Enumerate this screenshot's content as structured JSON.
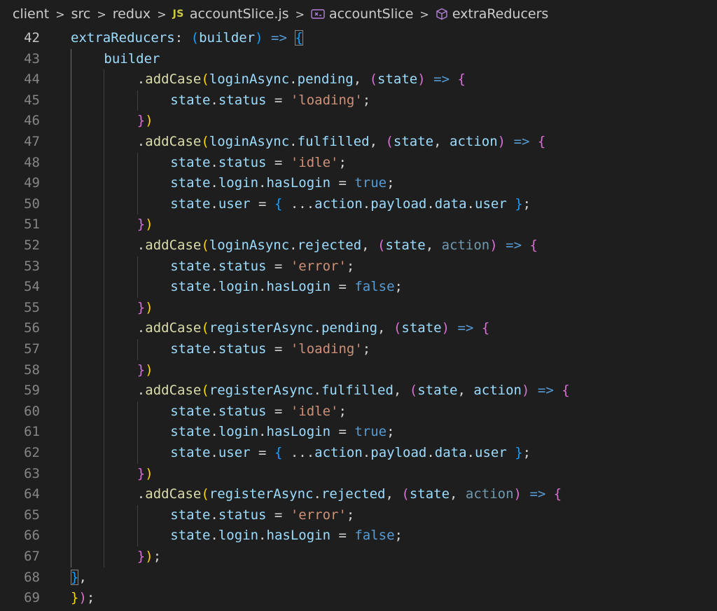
{
  "breadcrumb": {
    "items": [
      "client",
      "src",
      "redux"
    ],
    "file_badge": "JS",
    "file_name": "accountSlice.js",
    "symbol": "accountSlice",
    "member": "extraReducers",
    "separator": ">"
  },
  "editor": {
    "active_line": 42,
    "lines": [
      {
        "n": 42,
        "indent": 1,
        "tokens": [
          [
            "prop",
            "extraReducers"
          ],
          [
            "p",
            ": "
          ],
          [
            "b3",
            "("
          ],
          [
            "prop",
            "builder"
          ],
          [
            "b3",
            ")"
          ],
          [
            "p",
            " "
          ],
          [
            "kw",
            "=>"
          ],
          [
            "p",
            " "
          ],
          [
            "b3",
            "{"
          ]
        ]
      },
      {
        "n": 43,
        "indent": 2,
        "tokens": [
          [
            "prop",
            "builder"
          ]
        ]
      },
      {
        "n": 44,
        "indent": 3,
        "tokens": [
          [
            "p",
            "."
          ],
          [
            "fn",
            "addCase"
          ],
          [
            "b1",
            "("
          ],
          [
            "prop",
            "loginAsync"
          ],
          [
            "p",
            "."
          ],
          [
            "prop",
            "pending"
          ],
          [
            "p",
            ", "
          ],
          [
            "b2",
            "("
          ],
          [
            "prop",
            "state"
          ],
          [
            "b2",
            ")"
          ],
          [
            "p",
            " "
          ],
          [
            "kw",
            "=>"
          ],
          [
            "p",
            " "
          ],
          [
            "b2",
            "{"
          ]
        ]
      },
      {
        "n": 45,
        "indent": 4,
        "tokens": [
          [
            "prop",
            "state"
          ],
          [
            "p",
            "."
          ],
          [
            "prop",
            "status"
          ],
          [
            "p",
            " = "
          ],
          [
            "str",
            "'loading'"
          ],
          [
            "p",
            ";"
          ]
        ]
      },
      {
        "n": 46,
        "indent": 3,
        "tokens": [
          [
            "b2",
            "}"
          ],
          [
            "b1",
            ")"
          ]
        ]
      },
      {
        "n": 47,
        "indent": 3,
        "tokens": [
          [
            "p",
            "."
          ],
          [
            "fn",
            "addCase"
          ],
          [
            "b1",
            "("
          ],
          [
            "prop",
            "loginAsync"
          ],
          [
            "p",
            "."
          ],
          [
            "prop",
            "fulfilled"
          ],
          [
            "p",
            ", "
          ],
          [
            "b2",
            "("
          ],
          [
            "prop",
            "state"
          ],
          [
            "p",
            ", "
          ],
          [
            "prop",
            "action"
          ],
          [
            "b2",
            ")"
          ],
          [
            "p",
            " "
          ],
          [
            "kw",
            "=>"
          ],
          [
            "p",
            " "
          ],
          [
            "b2",
            "{"
          ]
        ]
      },
      {
        "n": 48,
        "indent": 4,
        "tokens": [
          [
            "prop",
            "state"
          ],
          [
            "p",
            "."
          ],
          [
            "prop",
            "status"
          ],
          [
            "p",
            " = "
          ],
          [
            "str",
            "'idle'"
          ],
          [
            "p",
            ";"
          ]
        ]
      },
      {
        "n": 49,
        "indent": 4,
        "tokens": [
          [
            "prop",
            "state"
          ],
          [
            "p",
            "."
          ],
          [
            "prop",
            "login"
          ],
          [
            "p",
            "."
          ],
          [
            "prop",
            "hasLogin"
          ],
          [
            "p",
            " = "
          ],
          [
            "kw",
            "true"
          ],
          [
            "p",
            ";"
          ]
        ]
      },
      {
        "n": 50,
        "indent": 4,
        "tokens": [
          [
            "prop",
            "state"
          ],
          [
            "p",
            "."
          ],
          [
            "prop",
            "user"
          ],
          [
            "p",
            " = "
          ],
          [
            "b3",
            "{"
          ],
          [
            "p",
            " ..."
          ],
          [
            "prop",
            "action"
          ],
          [
            "p",
            "."
          ],
          [
            "prop",
            "payload"
          ],
          [
            "p",
            "."
          ],
          [
            "prop",
            "data"
          ],
          [
            "p",
            "."
          ],
          [
            "prop",
            "user"
          ],
          [
            "p",
            " "
          ],
          [
            "b3",
            "}"
          ],
          [
            "p",
            ";"
          ]
        ]
      },
      {
        "n": 51,
        "indent": 3,
        "tokens": [
          [
            "b2",
            "}"
          ],
          [
            "b1",
            ")"
          ]
        ]
      },
      {
        "n": 52,
        "indent": 3,
        "tokens": [
          [
            "p",
            "."
          ],
          [
            "fn",
            "addCase"
          ],
          [
            "b1",
            "("
          ],
          [
            "prop",
            "loginAsync"
          ],
          [
            "p",
            "."
          ],
          [
            "prop",
            "rejected"
          ],
          [
            "p",
            ", "
          ],
          [
            "b2",
            "("
          ],
          [
            "prop",
            "state"
          ],
          [
            "p",
            ", "
          ],
          [
            "dim",
            "action"
          ],
          [
            "b2",
            ")"
          ],
          [
            "p",
            " "
          ],
          [
            "kw",
            "=>"
          ],
          [
            "p",
            " "
          ],
          [
            "b2",
            "{"
          ]
        ]
      },
      {
        "n": 53,
        "indent": 4,
        "tokens": [
          [
            "prop",
            "state"
          ],
          [
            "p",
            "."
          ],
          [
            "prop",
            "status"
          ],
          [
            "p",
            " = "
          ],
          [
            "str",
            "'error'"
          ],
          [
            "p",
            ";"
          ]
        ]
      },
      {
        "n": 54,
        "indent": 4,
        "tokens": [
          [
            "prop",
            "state"
          ],
          [
            "p",
            "."
          ],
          [
            "prop",
            "login"
          ],
          [
            "p",
            "."
          ],
          [
            "prop",
            "hasLogin"
          ],
          [
            "p",
            " = "
          ],
          [
            "kw",
            "false"
          ],
          [
            "p",
            ";"
          ]
        ]
      },
      {
        "n": 55,
        "indent": 3,
        "tokens": [
          [
            "b2",
            "}"
          ],
          [
            "b1",
            ")"
          ]
        ]
      },
      {
        "n": 56,
        "indent": 3,
        "tokens": [
          [
            "p",
            "."
          ],
          [
            "fn",
            "addCase"
          ],
          [
            "b1",
            "("
          ],
          [
            "prop",
            "registerAsync"
          ],
          [
            "p",
            "."
          ],
          [
            "prop",
            "pending"
          ],
          [
            "p",
            ", "
          ],
          [
            "b2",
            "("
          ],
          [
            "prop",
            "state"
          ],
          [
            "b2",
            ")"
          ],
          [
            "p",
            " "
          ],
          [
            "kw",
            "=>"
          ],
          [
            "p",
            " "
          ],
          [
            "b2",
            "{"
          ]
        ]
      },
      {
        "n": 57,
        "indent": 4,
        "tokens": [
          [
            "prop",
            "state"
          ],
          [
            "p",
            "."
          ],
          [
            "prop",
            "status"
          ],
          [
            "p",
            " = "
          ],
          [
            "str",
            "'loading'"
          ],
          [
            "p",
            ";"
          ]
        ]
      },
      {
        "n": 58,
        "indent": 3,
        "tokens": [
          [
            "b2",
            "}"
          ],
          [
            "b1",
            ")"
          ]
        ]
      },
      {
        "n": 59,
        "indent": 3,
        "tokens": [
          [
            "p",
            "."
          ],
          [
            "fn",
            "addCase"
          ],
          [
            "b1",
            "("
          ],
          [
            "prop",
            "registerAsync"
          ],
          [
            "p",
            "."
          ],
          [
            "prop",
            "fulfilled"
          ],
          [
            "p",
            ", "
          ],
          [
            "b2",
            "("
          ],
          [
            "prop",
            "state"
          ],
          [
            "p",
            ", "
          ],
          [
            "prop",
            "action"
          ],
          [
            "b2",
            ")"
          ],
          [
            "p",
            " "
          ],
          [
            "kw",
            "=>"
          ],
          [
            "p",
            " "
          ],
          [
            "b2",
            "{"
          ]
        ]
      },
      {
        "n": 60,
        "indent": 4,
        "tokens": [
          [
            "prop",
            "state"
          ],
          [
            "p",
            "."
          ],
          [
            "prop",
            "status"
          ],
          [
            "p",
            " = "
          ],
          [
            "str",
            "'idle'"
          ],
          [
            "p",
            ";"
          ]
        ]
      },
      {
        "n": 61,
        "indent": 4,
        "tokens": [
          [
            "prop",
            "state"
          ],
          [
            "p",
            "."
          ],
          [
            "prop",
            "login"
          ],
          [
            "p",
            "."
          ],
          [
            "prop",
            "hasLogin"
          ],
          [
            "p",
            " = "
          ],
          [
            "kw",
            "true"
          ],
          [
            "p",
            ";"
          ]
        ]
      },
      {
        "n": 62,
        "indent": 4,
        "tokens": [
          [
            "prop",
            "state"
          ],
          [
            "p",
            "."
          ],
          [
            "prop",
            "user"
          ],
          [
            "p",
            " = "
          ],
          [
            "b3",
            "{"
          ],
          [
            "p",
            " ..."
          ],
          [
            "prop",
            "action"
          ],
          [
            "p",
            "."
          ],
          [
            "prop",
            "payload"
          ],
          [
            "p",
            "."
          ],
          [
            "prop",
            "data"
          ],
          [
            "p",
            "."
          ],
          [
            "prop",
            "user"
          ],
          [
            "p",
            " "
          ],
          [
            "b3",
            "}"
          ],
          [
            "p",
            ";"
          ]
        ]
      },
      {
        "n": 63,
        "indent": 3,
        "tokens": [
          [
            "b2",
            "}"
          ],
          [
            "b1",
            ")"
          ]
        ]
      },
      {
        "n": 64,
        "indent": 3,
        "tokens": [
          [
            "p",
            "."
          ],
          [
            "fn",
            "addCase"
          ],
          [
            "b1",
            "("
          ],
          [
            "prop",
            "registerAsync"
          ],
          [
            "p",
            "."
          ],
          [
            "prop",
            "rejected"
          ],
          [
            "p",
            ", "
          ],
          [
            "b2",
            "("
          ],
          [
            "prop",
            "state"
          ],
          [
            "p",
            ", "
          ],
          [
            "dim",
            "action"
          ],
          [
            "b2",
            ")"
          ],
          [
            "p",
            " "
          ],
          [
            "kw",
            "=>"
          ],
          [
            "p",
            " "
          ],
          [
            "b2",
            "{"
          ]
        ]
      },
      {
        "n": 65,
        "indent": 4,
        "tokens": [
          [
            "prop",
            "state"
          ],
          [
            "p",
            "."
          ],
          [
            "prop",
            "status"
          ],
          [
            "p",
            " = "
          ],
          [
            "str",
            "'error'"
          ],
          [
            "p",
            ";"
          ]
        ]
      },
      {
        "n": 66,
        "indent": 4,
        "tokens": [
          [
            "prop",
            "state"
          ],
          [
            "p",
            "."
          ],
          [
            "prop",
            "login"
          ],
          [
            "p",
            "."
          ],
          [
            "prop",
            "hasLogin"
          ],
          [
            "p",
            " = "
          ],
          [
            "kw",
            "false"
          ],
          [
            "p",
            ";"
          ]
        ]
      },
      {
        "n": 67,
        "indent": 3,
        "tokens": [
          [
            "b2",
            "}"
          ],
          [
            "b1",
            ")"
          ],
          [
            "p",
            ";"
          ]
        ]
      },
      {
        "n": 68,
        "indent": 1,
        "tokens": [
          [
            "b3",
            "}"
          ],
          [
            "p",
            ","
          ]
        ]
      },
      {
        "n": 69,
        "indent": 0,
        "tokens": [
          [
            "b1",
            "}"
          ],
          [
            "b2",
            ")"
          ],
          [
            "p",
            ";"
          ]
        ]
      }
    ]
  },
  "colors": {
    "background": "#1e1e1e",
    "property": "#9cdcfe",
    "function": "#dcdcaa",
    "string": "#ce9178",
    "keyword": "#569cd6",
    "bracket_gold": "#ffd700",
    "bracket_orchid": "#da70d6",
    "bracket_blue": "#179fff"
  }
}
